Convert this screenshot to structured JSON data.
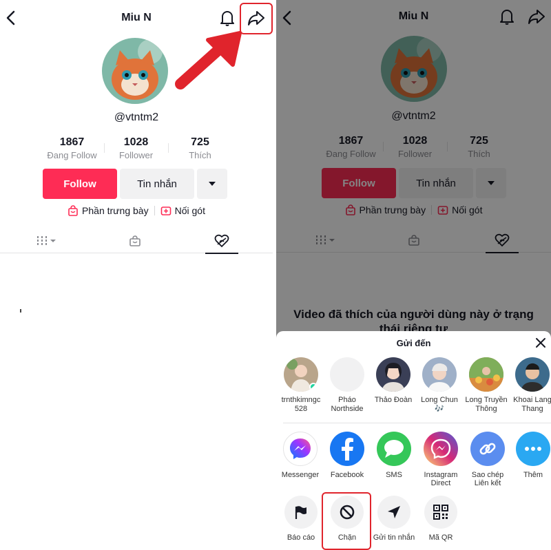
{
  "profile": {
    "title": "Miu N",
    "handle": "@vtntm2",
    "stats": [
      {
        "value": "1867",
        "label": "Đang Follow"
      },
      {
        "value": "1028",
        "label": "Follower"
      },
      {
        "value": "725",
        "label": "Thích"
      }
    ],
    "follow_label": "Follow",
    "message_label": "Tin nhắn",
    "showcase_label": "Phần trưng bày",
    "duet_label": "Nối gót"
  },
  "private_message": "Video đã thích của người dùng này ở trạng thái riêng tư",
  "share_sheet": {
    "title": "Gửi đến",
    "contacts": [
      {
        "name": "trnthkimngc\n528",
        "color": "#b9a58b"
      },
      {
        "name": "Pháo\nNorthside",
        "color": "#f1f1f2"
      },
      {
        "name": "Thảo Đoàn",
        "color": "#3a3f56"
      },
      {
        "name": "Long Chun\n🎶",
        "color": "#8fa0b8"
      },
      {
        "name": "Long Truyền\nThông",
        "color": "#b07a4a"
      },
      {
        "name": "Khoai Lang\nThang",
        "color": "#3d6b8c"
      }
    ],
    "apps": [
      {
        "label": "Messenger",
        "icon": "messenger-icon",
        "color": "#ffffff"
      },
      {
        "label": "Facebook",
        "icon": "facebook-icon",
        "color": "#1877f2"
      },
      {
        "label": "SMS",
        "icon": "sms-icon",
        "color": "#35c759"
      },
      {
        "label": "Instagram\nDirect",
        "icon": "instagram-direct-icon",
        "color": "#d6249f"
      },
      {
        "label": "Sao chép\nLiên kết",
        "icon": "link-icon",
        "color": "#5b8def"
      },
      {
        "label": "Thêm",
        "icon": "more-icon",
        "color": "#2aa8f2"
      }
    ],
    "actions": [
      {
        "label": "Báo cáo",
        "icon": "flag-icon"
      },
      {
        "label": "Chặn",
        "icon": "block-icon"
      },
      {
        "label": "Gửi tin nhắn",
        "icon": "send-icon"
      },
      {
        "label": "Mã QR",
        "icon": "qr-code-icon"
      }
    ]
  },
  "colors": {
    "accent": "#fe2c55",
    "highlight": "#e0242c"
  }
}
